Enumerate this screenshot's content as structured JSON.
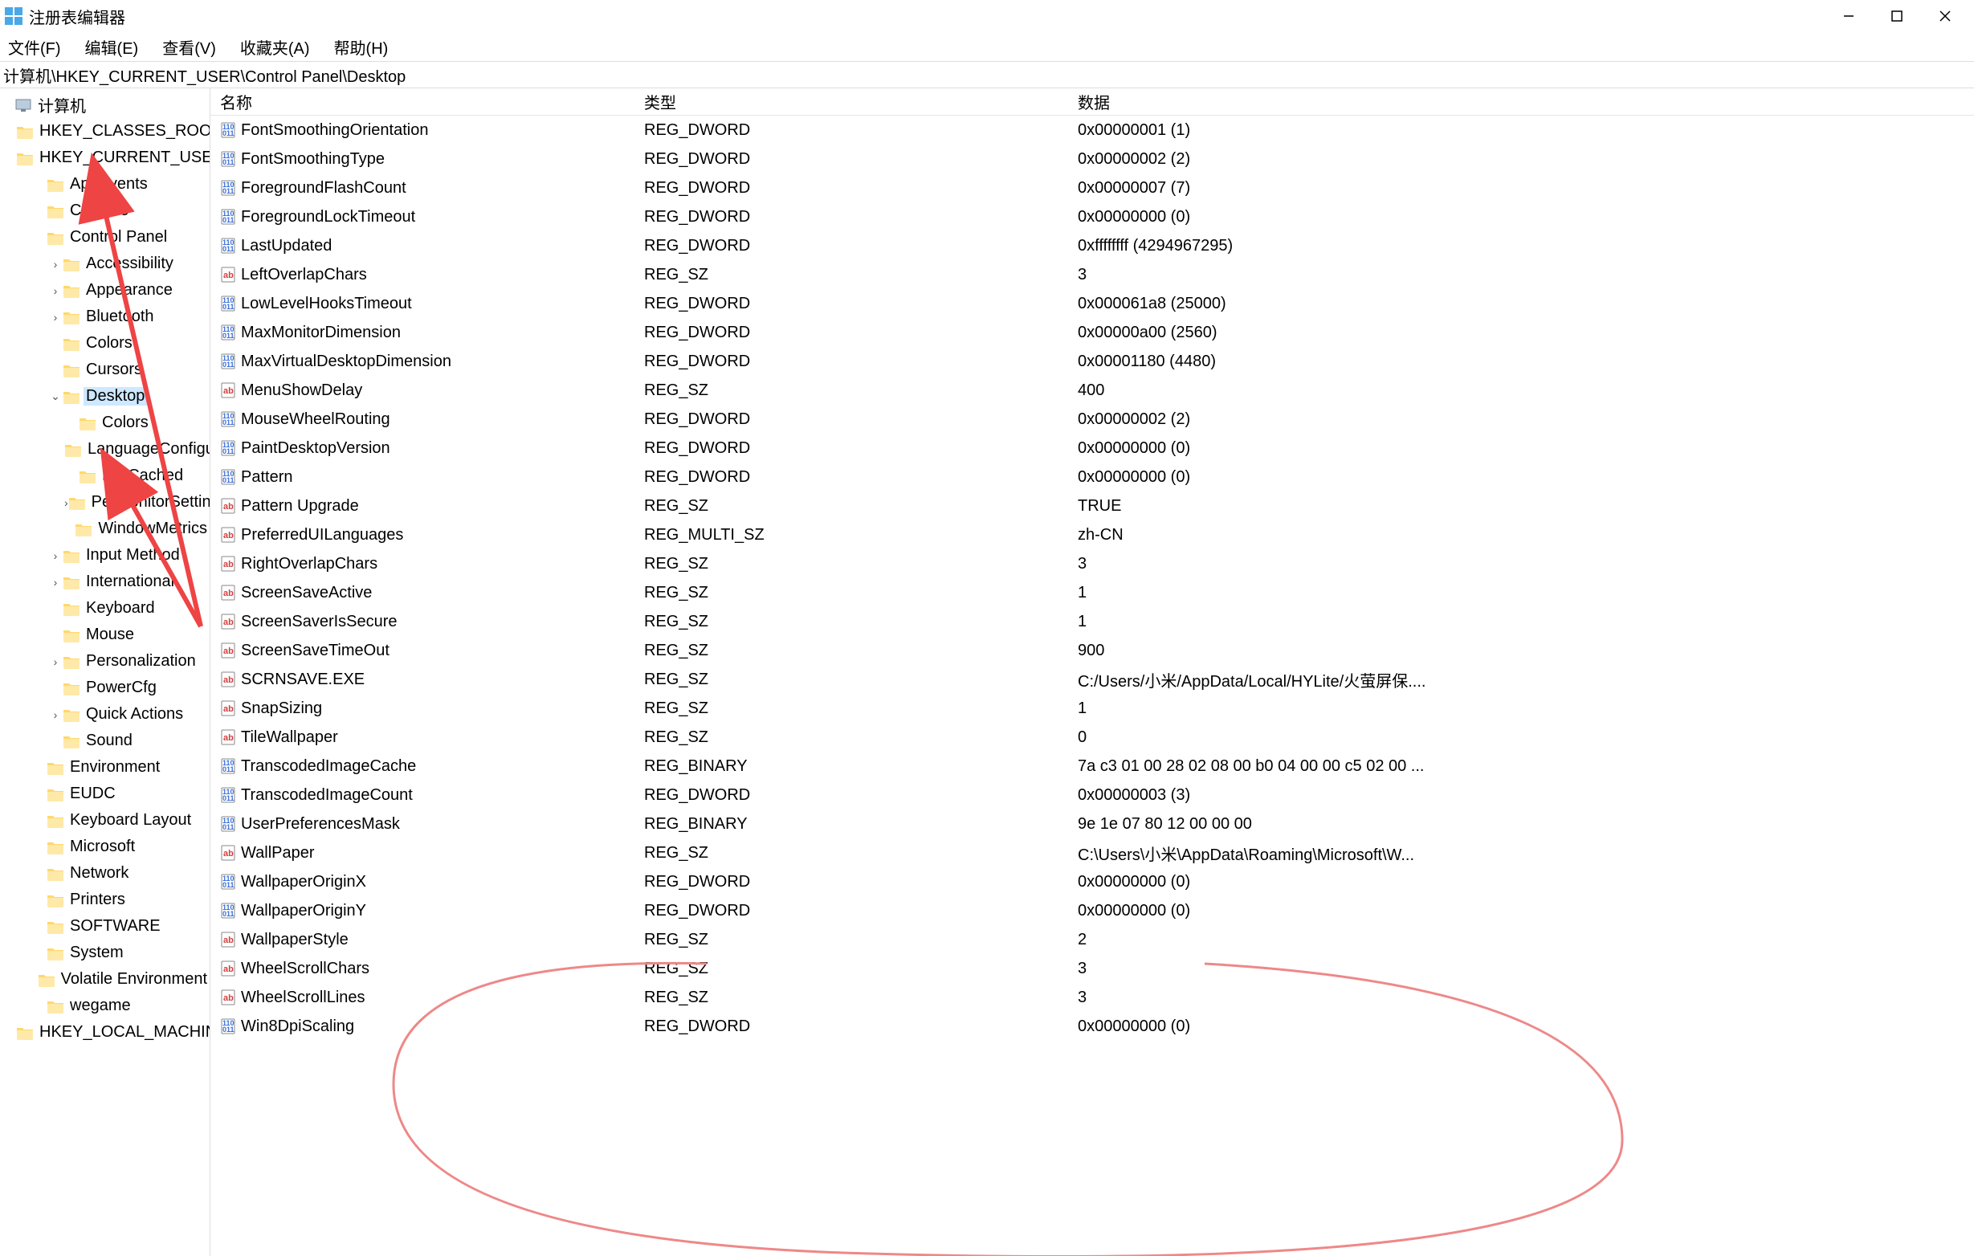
{
  "window": {
    "title": "注册表编辑器"
  },
  "menubar": {
    "items": [
      "文件(F)",
      "编辑(E)",
      "查看(V)",
      "收藏夹(A)",
      "帮助(H)"
    ]
  },
  "address": "计算机\\HKEY_CURRENT_USER\\Control Panel\\Desktop",
  "tree": [
    {
      "label": "计算机",
      "indent": 0,
      "expander": "",
      "icon": "pc"
    },
    {
      "label": "HKEY_CLASSES_ROOT",
      "indent": 1,
      "expander": "",
      "icon": "folder"
    },
    {
      "label": "HKEY_CURRENT_USER",
      "indent": 1,
      "expander": "",
      "icon": "folder"
    },
    {
      "label": "AppEvents",
      "indent": 2,
      "expander": "",
      "icon": "folder"
    },
    {
      "label": "Console",
      "indent": 2,
      "expander": "",
      "icon": "folder"
    },
    {
      "label": "Control Panel",
      "indent": 2,
      "expander": "",
      "icon": "folder"
    },
    {
      "label": "Accessibility",
      "indent": 3,
      "expander": "›",
      "icon": "folder"
    },
    {
      "label": "Appearance",
      "indent": 3,
      "expander": "›",
      "icon": "folder"
    },
    {
      "label": "Bluetooth",
      "indent": 3,
      "expander": "›",
      "icon": "folder"
    },
    {
      "label": "Colors",
      "indent": 3,
      "expander": "",
      "icon": "folder"
    },
    {
      "label": "Cursors",
      "indent": 3,
      "expander": "",
      "icon": "folder"
    },
    {
      "label": "Desktop",
      "indent": 3,
      "expander": "⌄",
      "icon": "folder",
      "selected": true
    },
    {
      "label": "Colors",
      "indent": 4,
      "expander": "",
      "icon": "folder"
    },
    {
      "label": "LanguageConfiguration",
      "indent": 4,
      "expander": "",
      "icon": "folder"
    },
    {
      "label": "MuiCached",
      "indent": 4,
      "expander": "",
      "icon": "folder"
    },
    {
      "label": "PerMonitorSettings",
      "indent": 4,
      "expander": "›",
      "icon": "folder"
    },
    {
      "label": "WindowMetrics",
      "indent": 4,
      "expander": "",
      "icon": "folder"
    },
    {
      "label": "Input Method",
      "indent": 3,
      "expander": "›",
      "icon": "folder"
    },
    {
      "label": "International",
      "indent": 3,
      "expander": "›",
      "icon": "folder"
    },
    {
      "label": "Keyboard",
      "indent": 3,
      "expander": "",
      "icon": "folder"
    },
    {
      "label": "Mouse",
      "indent": 3,
      "expander": "",
      "icon": "folder"
    },
    {
      "label": "Personalization",
      "indent": 3,
      "expander": "›",
      "icon": "folder"
    },
    {
      "label": "PowerCfg",
      "indent": 3,
      "expander": "",
      "icon": "folder"
    },
    {
      "label": "Quick Actions",
      "indent": 3,
      "expander": "›",
      "icon": "folder"
    },
    {
      "label": "Sound",
      "indent": 3,
      "expander": "",
      "icon": "folder"
    },
    {
      "label": "Environment",
      "indent": 2,
      "expander": "",
      "icon": "folder"
    },
    {
      "label": "EUDC",
      "indent": 2,
      "expander": "",
      "icon": "folder"
    },
    {
      "label": "Keyboard Layout",
      "indent": 2,
      "expander": "",
      "icon": "folder"
    },
    {
      "label": "Microsoft",
      "indent": 2,
      "expander": "",
      "icon": "folder"
    },
    {
      "label": "Network",
      "indent": 2,
      "expander": "",
      "icon": "folder"
    },
    {
      "label": "Printers",
      "indent": 2,
      "expander": "",
      "icon": "folder"
    },
    {
      "label": "SOFTWARE",
      "indent": 2,
      "expander": "",
      "icon": "folder"
    },
    {
      "label": "System",
      "indent": 2,
      "expander": "",
      "icon": "folder"
    },
    {
      "label": "Volatile Environment",
      "indent": 2,
      "expander": "",
      "icon": "folder"
    },
    {
      "label": "wegame",
      "indent": 2,
      "expander": "",
      "icon": "folder"
    },
    {
      "label": "HKEY_LOCAL_MACHINE",
      "indent": 1,
      "expander": "",
      "icon": "folder"
    }
  ],
  "columns": {
    "name": "名称",
    "type": "类型",
    "data": "数据"
  },
  "values": [
    {
      "name": "FontSmoothingOrientation",
      "type": "REG_DWORD",
      "data": "0x00000001 (1)",
      "icon": "bin"
    },
    {
      "name": "FontSmoothingType",
      "type": "REG_DWORD",
      "data": "0x00000002 (2)",
      "icon": "bin"
    },
    {
      "name": "ForegroundFlashCount",
      "type": "REG_DWORD",
      "data": "0x00000007 (7)",
      "icon": "bin"
    },
    {
      "name": "ForegroundLockTimeout",
      "type": "REG_DWORD",
      "data": "0x00000000 (0)",
      "icon": "bin"
    },
    {
      "name": "LastUpdated",
      "type": "REG_DWORD",
      "data": "0xffffffff (4294967295)",
      "icon": "bin"
    },
    {
      "name": "LeftOverlapChars",
      "type": "REG_SZ",
      "data": "3",
      "icon": "sz"
    },
    {
      "name": "LowLevelHooksTimeout",
      "type": "REG_DWORD",
      "data": "0x000061a8 (25000)",
      "icon": "bin"
    },
    {
      "name": "MaxMonitorDimension",
      "type": "REG_DWORD",
      "data": "0x00000a00 (2560)",
      "icon": "bin"
    },
    {
      "name": "MaxVirtualDesktopDimension",
      "type": "REG_DWORD",
      "data": "0x00001180 (4480)",
      "icon": "bin"
    },
    {
      "name": "MenuShowDelay",
      "type": "REG_SZ",
      "data": "400",
      "icon": "sz"
    },
    {
      "name": "MouseWheelRouting",
      "type": "REG_DWORD",
      "data": "0x00000002 (2)",
      "icon": "bin"
    },
    {
      "name": "PaintDesktopVersion",
      "type": "REG_DWORD",
      "data": "0x00000000 (0)",
      "icon": "bin"
    },
    {
      "name": "Pattern",
      "type": "REG_DWORD",
      "data": "0x00000000 (0)",
      "icon": "bin"
    },
    {
      "name": "Pattern Upgrade",
      "type": "REG_SZ",
      "data": "TRUE",
      "icon": "sz"
    },
    {
      "name": "PreferredUILanguages",
      "type": "REG_MULTI_SZ",
      "data": "zh-CN",
      "icon": "sz"
    },
    {
      "name": "RightOverlapChars",
      "type": "REG_SZ",
      "data": "3",
      "icon": "sz"
    },
    {
      "name": "ScreenSaveActive",
      "type": "REG_SZ",
      "data": "1",
      "icon": "sz"
    },
    {
      "name": "ScreenSaverIsSecure",
      "type": "REG_SZ",
      "data": "1",
      "icon": "sz"
    },
    {
      "name": "ScreenSaveTimeOut",
      "type": "REG_SZ",
      "data": "900",
      "icon": "sz"
    },
    {
      "name": "SCRNSAVE.EXE",
      "type": "REG_SZ",
      "data": "C:/Users/小米/AppData/Local/HYLite/火萤屏保....",
      "icon": "sz"
    },
    {
      "name": "SnapSizing",
      "type": "REG_SZ",
      "data": "1",
      "icon": "sz"
    },
    {
      "name": "TileWallpaper",
      "type": "REG_SZ",
      "data": "0",
      "icon": "sz"
    },
    {
      "name": "TranscodedImageCache",
      "type": "REG_BINARY",
      "data": "7a c3 01 00 28 02 08 00 b0 04 00 00 c5 02 00 ...",
      "icon": "bin"
    },
    {
      "name": "TranscodedImageCount",
      "type": "REG_DWORD",
      "data": "0x00000003 (3)",
      "icon": "bin"
    },
    {
      "name": "UserPreferencesMask",
      "type": "REG_BINARY",
      "data": "9e 1e 07 80 12 00 00 00",
      "icon": "bin"
    },
    {
      "name": "WallPaper",
      "type": "REG_SZ",
      "data": "C:\\Users\\小米\\AppData\\Roaming\\Microsoft\\W...",
      "icon": "sz"
    },
    {
      "name": "WallpaperOriginX",
      "type": "REG_DWORD",
      "data": "0x00000000 (0)",
      "icon": "bin"
    },
    {
      "name": "WallpaperOriginY",
      "type": "REG_DWORD",
      "data": "0x00000000 (0)",
      "icon": "bin"
    },
    {
      "name": "WallpaperStyle",
      "type": "REG_SZ",
      "data": "2",
      "icon": "sz"
    },
    {
      "name": "WheelScrollChars",
      "type": "REG_SZ",
      "data": "3",
      "icon": "sz"
    },
    {
      "name": "WheelScrollLines",
      "type": "REG_SZ",
      "data": "3",
      "icon": "sz"
    },
    {
      "name": "Win8DpiScaling",
      "type": "REG_DWORD",
      "data": "0x00000000 (0)",
      "icon": "bin"
    }
  ]
}
